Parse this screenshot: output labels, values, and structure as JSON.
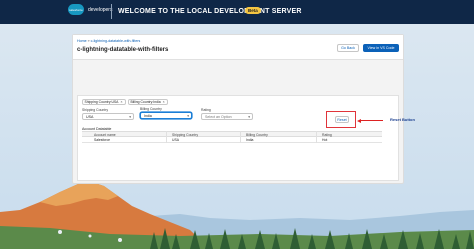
{
  "topbar": {
    "logo_text": "salesforce",
    "brand": "developers",
    "title": "WELCOME TO THE LOCAL DEVELOPMENT SERVER",
    "badge": "Beta"
  },
  "header": {
    "breadcrumb_home": "Home",
    "breadcrumb_sep": "»",
    "breadcrumb_current": "c-lightning-datatable-with-filters",
    "title": "c-lightning-datatable-with-filters",
    "go_back": "Go Back",
    "view_in_vscode": "View in VS Code"
  },
  "filters": {
    "pills": [
      {
        "label": "Shipping Country:USA",
        "remove": "×"
      },
      {
        "label": "Billing Country:India",
        "remove": "×"
      }
    ],
    "shipping": {
      "label": "Shipping Country",
      "value": "USA"
    },
    "billing": {
      "label": "Billing Country",
      "value": "India"
    },
    "rating": {
      "label": "Rating",
      "placeholder": "Select an Option"
    },
    "reset": "Reset",
    "annotation": "Reset Button"
  },
  "table": {
    "title": "Account Datatable",
    "columns": [
      "Account name",
      "Shipping Country",
      "Billing Country",
      "Rating"
    ],
    "rows": [
      [
        "Salesforce",
        "USA",
        "India",
        "Hot"
      ]
    ]
  },
  "colors": {
    "topbar": "#0f2747",
    "accent": "#0b61b8",
    "annotation_red": "#e0343a",
    "annotation_text": "#1b3f8f"
  }
}
